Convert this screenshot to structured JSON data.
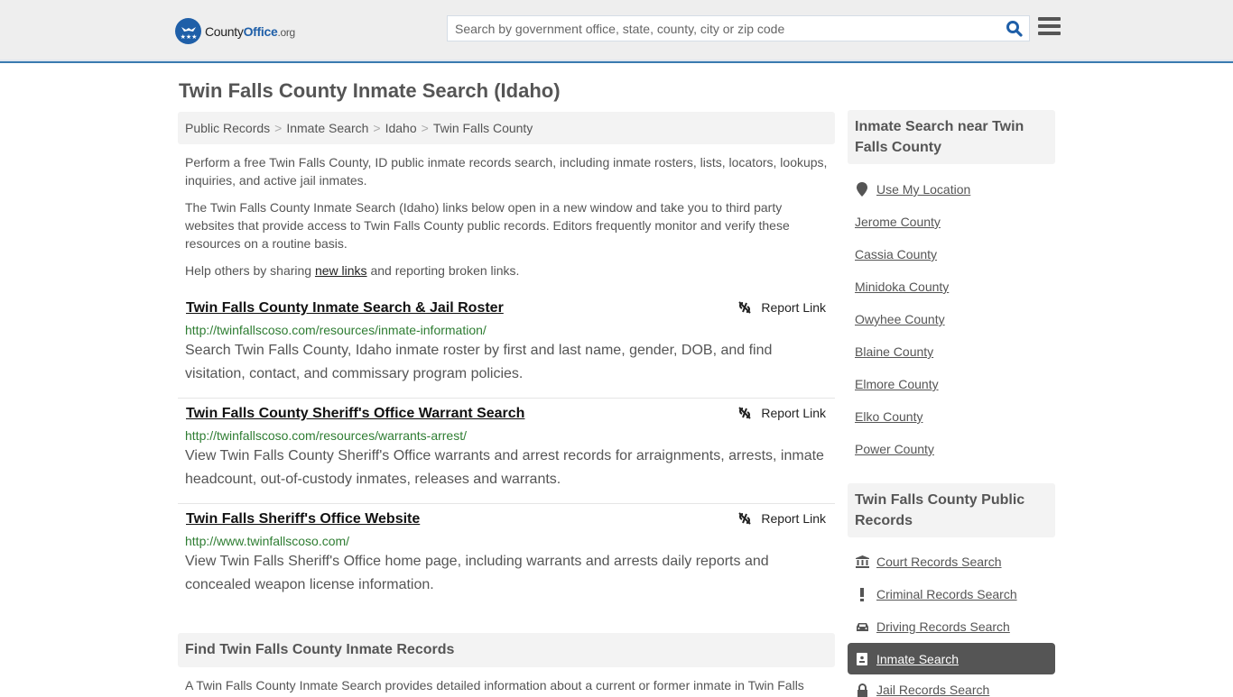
{
  "header": {
    "logo": {
      "name_a": "County",
      "name_b": "Office",
      "name_c": ".org"
    },
    "search": {
      "placeholder": "Search by government office, state, county, city or zip code",
      "value": ""
    },
    "colors": {
      "brand": "#1f5fa8",
      "accent_bar": "#3a7bb0"
    }
  },
  "page": {
    "title": "Twin Falls County Inmate Search (Idaho)",
    "breadcrumb": [
      "Public Records",
      "Inmate Search",
      "Idaho",
      "Twin Falls County"
    ],
    "breadcrumb_sep": ">",
    "intro1": "Perform a free Twin Falls County, ID public inmate records search, including inmate rosters, lists, locators, lookups, inquiries, and active jail inmates.",
    "intro2": "The Twin Falls County Inmate Search (Idaho) links below open in a new window and take you to third party websites that provide access to Twin Falls County public records. Editors frequently monitor and verify these resources on a routine basis.",
    "intro3_pre": "Help others by sharing ",
    "intro3_link": "new links",
    "intro3_post": " and reporting broken links."
  },
  "results": [
    {
      "title": "Twin Falls County Inmate Search & Jail Roster",
      "url": "http://twinfallscoso.com/resources/inmate-information/",
      "desc": "Search Twin Falls County, Idaho inmate roster by first and last name, gender, DOB, and find visitation, contact, and commissary program policies.",
      "report": "Report Link"
    },
    {
      "title": "Twin Falls County Sheriff's Office Warrant Search",
      "url": "http://twinfallscoso.com/resources/warrants-arrest/",
      "desc": "View Twin Falls County Sheriff's Office warrants and arrest records for arraignments, arrests, inmate headcount, out-of-custody inmates, releases and warrants.",
      "report": "Report Link"
    },
    {
      "title": "Twin Falls Sheriff's Office Website",
      "url": "http://www.twinfallscoso.com/",
      "desc": "View Twin Falls Sheriff's Office home page, including warrants and arrests daily reports and concealed weapon license information.",
      "report": "Report Link"
    }
  ],
  "find_section": {
    "heading": "Find Twin Falls County Inmate Records",
    "text": "A Twin Falls County Inmate Search provides detailed information about a current or former inmate in Twin Falls"
  },
  "sidebar": {
    "nearby": {
      "heading": "Inmate Search near Twin Falls County",
      "use_location": "Use My Location",
      "items": [
        "Jerome County",
        "Cassia County",
        "Minidoka County",
        "Owyhee County",
        "Blaine County",
        "Elmore County",
        "Elko County",
        "Power County"
      ]
    },
    "public_records": {
      "heading": "Twin Falls County Public Records",
      "items": [
        {
          "label": "Court Records Search",
          "icon": "courthouse-icon"
        },
        {
          "label": "Criminal Records Search",
          "icon": "exclamation-icon"
        },
        {
          "label": "Driving Records Search",
          "icon": "car-icon"
        },
        {
          "label": "Inmate Search",
          "icon": "id-badge-icon",
          "active": true
        },
        {
          "label": "Jail Records Search",
          "icon": "lock-icon"
        }
      ]
    }
  }
}
